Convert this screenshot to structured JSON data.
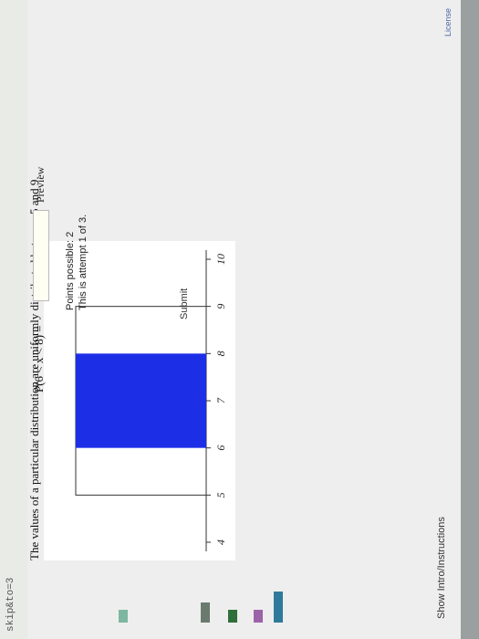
{
  "browser": {
    "url_fragment": "skip&to=3"
  },
  "header": {
    "show_intro_label": "Show Intro/Instructions"
  },
  "question": {
    "text": "The values of a particular distribution are uniformly distributed between 5 and 9."
  },
  "answer": {
    "label": "P(6 < x < 8) =",
    "input_value": "",
    "preview_label": "Preview"
  },
  "meta": {
    "points": "Points possible: 2",
    "attempt": "This is attempt 1 of 3."
  },
  "submit_label": "Submit",
  "license_label": "License",
  "colors": {
    "shaded_region": "#1c2fe6",
    "outline": "#333333",
    "page_bg": "#eeeeee"
  },
  "chart_data": {
    "type": "area",
    "x_ticks": [
      "4",
      "5",
      "6",
      "7",
      "8",
      "9",
      "10"
    ],
    "xlim": [
      4,
      10
    ],
    "distribution": {
      "kind": "uniform",
      "a": 5,
      "b": 9
    },
    "shaded": {
      "from": 6,
      "to": 8
    }
  }
}
